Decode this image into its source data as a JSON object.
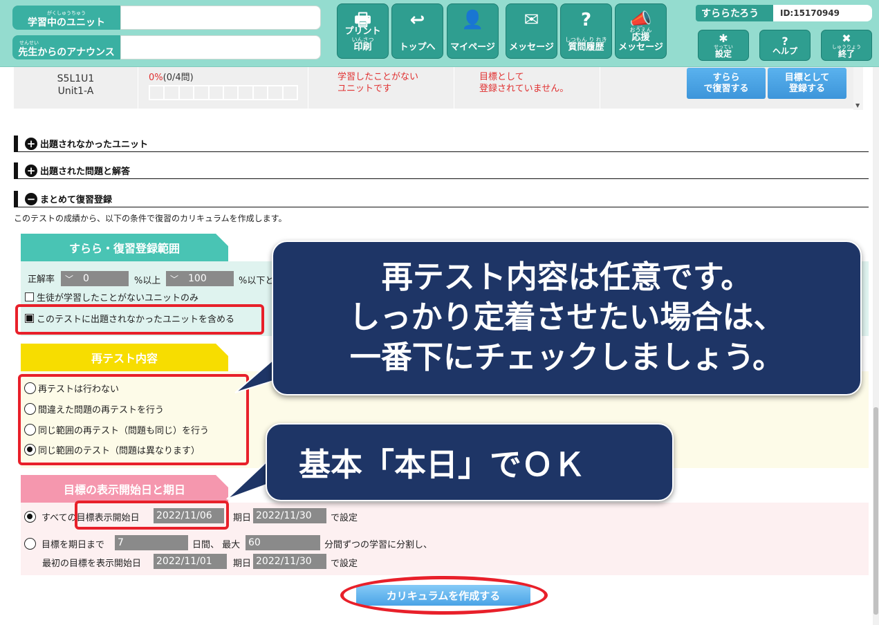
{
  "header": {
    "studying_unit_label": "学習中のユニット",
    "studying_unit_ruby": "がくしゅうちゅう",
    "teacher_announce_label": "先生からのアナウンス",
    "teacher_announce_ruby": "せんせい",
    "nav": [
      {
        "label": "プリント",
        "label2": "印刷",
        "ruby": "いんさつ",
        "icon": "printer-icon",
        "glyph": "🖶"
      },
      {
        "label": "トップへ",
        "icon": "back-arrow-icon",
        "glyph": "↩"
      },
      {
        "label": "マイページ",
        "icon": "person-icon",
        "glyph": "👤"
      },
      {
        "label": "メッセージ",
        "icon": "envelope-icon",
        "glyph": "✉"
      },
      {
        "label": "質問履歴",
        "ruby": "しつもん り れき",
        "icon": "question-chat-icon",
        "glyph": "?"
      },
      {
        "label": "応援",
        "label2": "メッセージ",
        "ruby": "おうえん",
        "icon": "megaphone-icon",
        "glyph": "📣"
      }
    ],
    "user_name": "すららたろう",
    "user_id": "ID:15170949",
    "user_buttons": [
      {
        "label": "設定",
        "ruby": "せってい",
        "icon": "gear-icon",
        "glyph": "✱"
      },
      {
        "label": "ヘルプ",
        "icon": "help-icon",
        "glyph": "?"
      },
      {
        "label": "終了",
        "ruby": "しゅうりょう",
        "icon": "close-icon",
        "glyph": "✖"
      }
    ]
  },
  "unit_row": {
    "code": "S5L1U1",
    "name": "Unit1-A",
    "progress_percent": "0%",
    "progress_count": "(0/4問)",
    "status_line1": "学習したことがない",
    "status_line2": "ユニットです",
    "goal_line1": "目標として",
    "goal_line2": "登録されていません。",
    "review_btn_line1": "すらら",
    "review_btn_line2": "で復習する",
    "goal_btn_line1": "目標として",
    "goal_btn_line2": "登録する"
  },
  "sections": [
    {
      "label": "出題されなかったユニット",
      "symbol": "+"
    },
    {
      "label": "出題された問題と解答",
      "symbol": "+"
    },
    {
      "label": "まとめて復習登録",
      "symbol": "−"
    }
  ],
  "intro_text": "このテストの成績から、以下の条件で復習のカリキュラムを作成します。",
  "range_panel": {
    "title": "すらら・復習登録範囲",
    "accuracy_label": "正解率",
    "min_value": "0",
    "min_suffix": "%以上",
    "max_value": "100",
    "max_suffix": "%以下と",
    "checkbox_unlearned": "生徒が学習したことがないユニットのみ",
    "checkbox_include": "このテストに出題されなかったユニットを含める",
    "chevron": "﹀"
  },
  "retest_panel": {
    "title": "再テスト内容",
    "options": [
      {
        "label": "再テストは行わない",
        "checked": false
      },
      {
        "label": "間違えた問題の再テストを行う",
        "checked": false
      },
      {
        "label": "同じ範囲の再テスト（問題も同じ）を行う",
        "checked": false
      },
      {
        "label": "同じ範囲のテスト（問題は異なります）",
        "checked": true
      }
    ]
  },
  "goal_panel": {
    "title": "目標の表示開始日と期日",
    "opt1_prefix": "すべての",
    "opt1_start_label": "目標表示開始日",
    "opt1_start_date": "2022/11/06",
    "opt1_due_label": "期日",
    "opt1_due_date": "2022/11/30",
    "opt1_suffix": "で設定",
    "opt2_label": "目標を期日まで",
    "opt2_days": "7",
    "opt2_days_suffix": "日間、 最大",
    "opt2_minutes": "60",
    "opt2_minutes_suffix": "分間ずつの学習に分割し、",
    "opt2_line2_label": "最初の目標を表示開始日",
    "opt2_start_date": "2022/11/01",
    "opt2_due_label": "期日",
    "opt2_due_date": "2022/11/30",
    "opt2_suffix": "で設定"
  },
  "create_button": "カリキュラムを作成する",
  "callout_main": {
    "line1": "再テスト内容は任意です。",
    "line2": "しっかり定着させたい場合は、",
    "line3": "一番下にチェックしましょう。"
  },
  "callout_date": "基本「本日」でＯＫ",
  "colors": {
    "header_bg": "#94dccf",
    "nav_btn": "#2f9e90",
    "range_tab": "#49c4b4",
    "retest_tab": "#f7dd00",
    "goal_tab": "#f597ae",
    "callout": "#1e3566",
    "highlight": "#e8202a"
  }
}
